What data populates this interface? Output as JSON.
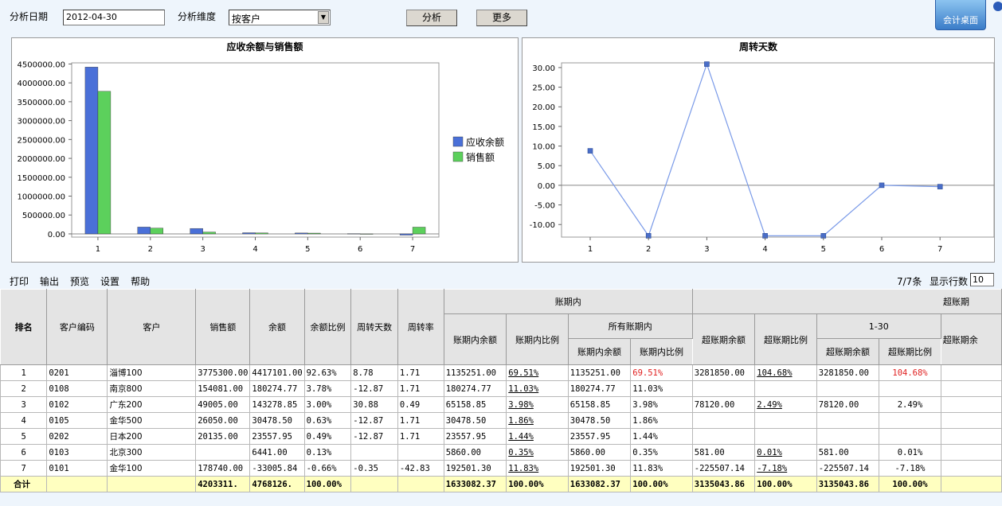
{
  "toolbar": {
    "date_label": "分析日期",
    "date_value": "2012-04-30",
    "dim_label": "分析维度",
    "dim_value": "按客户",
    "analyze_button": "分析",
    "more_button": "更多",
    "desktop_button": "会计桌面"
  },
  "bar_chart": {
    "title": "应收余额与销售额"
  },
  "line_chart": {
    "title": "周转天数"
  },
  "actions": {
    "print": "打印",
    "export": "输出",
    "preview": "预览",
    "settings": "设置",
    "help": "帮助",
    "count": "7/7条",
    "rows_label": "显示行数",
    "rows_value": "10"
  },
  "table": {
    "h": {
      "rank": "排名",
      "code": "客户编码",
      "customer": "客户",
      "sales": "销售额",
      "balance": "余额",
      "balance_ratio": "余额比例",
      "turnover_days": "周转天数",
      "turnover_rate": "周转率",
      "in_term": "账期内",
      "in_bal": "账期内余额",
      "in_ratio": "账期内比例",
      "all_in": "所有账期内",
      "all_in_bal": "账期内余额",
      "all_in_ratio": "账期内比例",
      "over": "超账期",
      "over_bal": "超账期余额",
      "over_ratio": "超账期比例",
      "r1_30": "1-30",
      "r_bal": "超账期余额",
      "r_ratio": "超账期比例",
      "r_bal2": "超账期余"
    },
    "rows": [
      [
        "1",
        "0201",
        "淄博100",
        "3775300.00",
        "4417101.00",
        "92.63%",
        "8.78",
        "1.71",
        "1135251.00",
        "69.51%",
        "1135251.00",
        "69.51%",
        "3281850.00",
        "104.68%",
        "3281850.00",
        "104.68%",
        ""
      ],
      [
        "2",
        "0108",
        "南京800",
        "154081.00",
        "180274.77",
        "3.78%",
        "-12.87",
        "1.71",
        "180274.77",
        "11.03%",
        "180274.77",
        "11.03%",
        "",
        "",
        "",
        "",
        ""
      ],
      [
        "3",
        "0102",
        "广东200",
        "49005.00",
        "143278.85",
        "3.00%",
        "30.88",
        "0.49",
        "65158.85",
        "3.98%",
        "65158.85",
        "3.98%",
        "78120.00",
        "2.49%",
        "78120.00",
        "2.49%",
        ""
      ],
      [
        "4",
        "0105",
        "金华500",
        "26050.00",
        "30478.50",
        "0.63%",
        "-12.87",
        "1.71",
        "30478.50",
        "1.86%",
        "30478.50",
        "1.86%",
        "",
        "",
        "",
        "",
        ""
      ],
      [
        "5",
        "0202",
        "日本200",
        "20135.00",
        "23557.95",
        "0.49%",
        "-12.87",
        "1.71",
        "23557.95",
        "1.44%",
        "23557.95",
        "1.44%",
        "",
        "",
        "",
        "",
        ""
      ],
      [
        "6",
        "0103",
        "北京300",
        "",
        "6441.00",
        "0.13%",
        "",
        "",
        "5860.00",
        "0.35%",
        "5860.00",
        "0.35%",
        "581.00",
        "0.01%",
        "581.00",
        "0.01%",
        ""
      ],
      [
        "7",
        "0101",
        "金华100",
        "178740.00",
        "-33005.84",
        "-0.66%",
        "-0.35",
        "-42.83",
        "192501.30",
        "11.83%",
        "192501.30",
        "11.83%",
        "-225507.14",
        "-7.18%",
        "-225507.14",
        "-7.18%",
        ""
      ]
    ],
    "total": [
      "合计",
      "",
      "",
      "4203311.",
      "4768126.",
      "100.00%",
      "",
      "",
      "1633082.37",
      "100.00%",
      "1633082.37",
      "100.00%",
      "3135043.86",
      "100.00%",
      "3135043.86",
      "100.00%",
      ""
    ]
  },
  "chart_data": [
    {
      "type": "bar",
      "title": "应收余额与销售额",
      "categories": [
        "1",
        "2",
        "3",
        "4",
        "5",
        "6",
        "7"
      ],
      "series": [
        {
          "name": "应收余额",
          "color": "#4a70d8",
          "values": [
            4417101,
            180274.77,
            143278.85,
            30478.5,
            23557.95,
            6441,
            -33005.84
          ]
        },
        {
          "name": "销售额",
          "color": "#5cd05c",
          "values": [
            3775300,
            154081,
            49005,
            26050,
            20135,
            0,
            178740
          ]
        }
      ],
      "yticks": [
        "0.00",
        "500000.00",
        "1000000.00",
        "1500000.00",
        "2000000.00",
        "2500000.00",
        "3000000.00",
        "3500000.00",
        "4000000.00",
        "4500000.00"
      ],
      "ylim": [
        -85000,
        4530000
      ],
      "legend": "right"
    },
    {
      "type": "line",
      "title": "周转天数",
      "categories": [
        "1",
        "2",
        "3",
        "4",
        "5",
        "6",
        "7"
      ],
      "values": [
        8.78,
        -12.87,
        30.88,
        -12.87,
        -12.87,
        0,
        -0.35
      ],
      "yticks": [
        "-10.00",
        "-5.00",
        "0.00",
        "5.00",
        "10.00",
        "15.00",
        "20.00",
        "25.00",
        "30.00"
      ],
      "ylim": [
        -13.2,
        31.2
      ],
      "color": "#7a9ae8"
    }
  ]
}
